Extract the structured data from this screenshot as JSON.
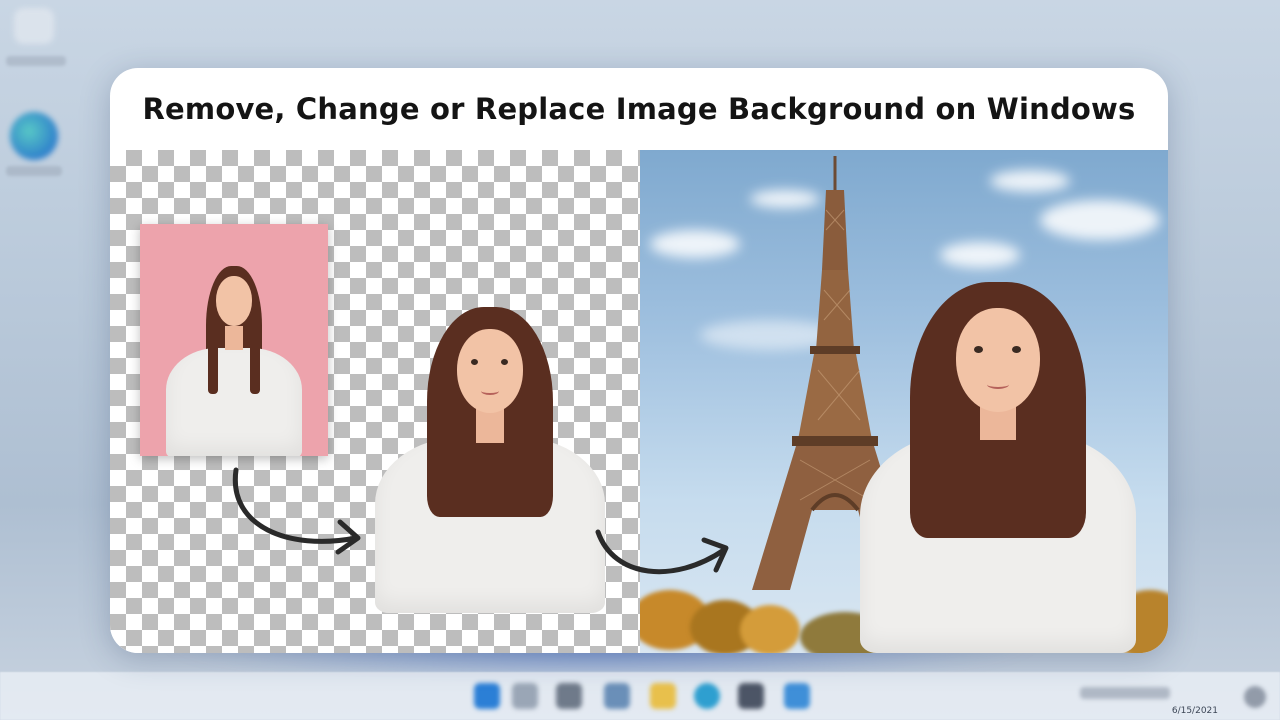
{
  "title": "Remove, Change or Replace Image Background on Windows",
  "taskbar": {
    "date": "6/15/2021",
    "icons": [
      "start-icon",
      "search-icon",
      "task-view-icon",
      "widgets-icon",
      "file-explorer-icon",
      "edge-icon",
      "store-icon",
      "mail-icon"
    ]
  },
  "desktop_icons": [
    "recycle-bin-icon",
    "edge-icon"
  ],
  "colors": {
    "pink_background": "#eda3ac",
    "transparent_checker": "#bdbdbd",
    "sky": "#9fc0df",
    "accent_taskbar": "#2457c9"
  }
}
